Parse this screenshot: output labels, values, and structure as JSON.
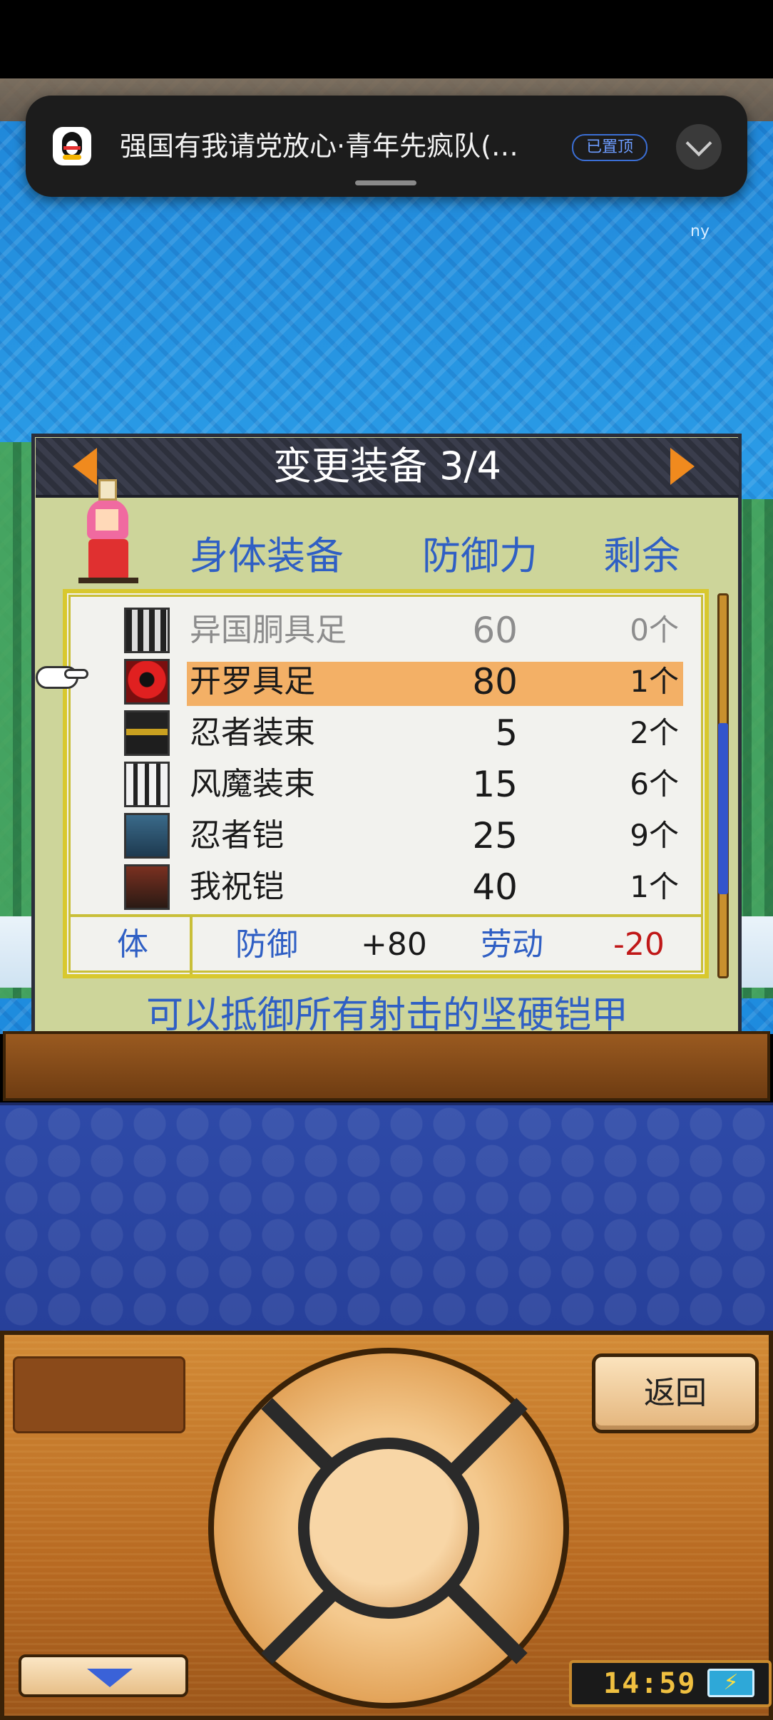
{
  "notification": {
    "app_icon": "qq-penguin-icon",
    "title": "强国有我请党放心·青年先疯队(…",
    "badge": "已置顶",
    "expand_icon": "chevron-down-icon"
  },
  "overlay_text": "ny",
  "dialog": {
    "title": "变更装备 3/4",
    "columns": {
      "body": "身体装备",
      "defense": "防御力",
      "remaining": "剩余"
    },
    "items": [
      {
        "name": "异国胴具足",
        "defense": "60",
        "remaining": "0个",
        "state": "disabled"
      },
      {
        "name": "开罗具足",
        "defense": "80",
        "remaining": "1个",
        "state": "selected"
      },
      {
        "name": "忍者装束",
        "defense": "5",
        "remaining": "2个",
        "state": "normal"
      },
      {
        "name": "风魔装束",
        "defense": "15",
        "remaining": "6个",
        "state": "normal"
      },
      {
        "name": "忍者铠",
        "defense": "25",
        "remaining": "9个",
        "state": "normal"
      },
      {
        "name": "我祝铠",
        "defense": "40",
        "remaining": "1个",
        "state": "normal"
      }
    ],
    "stats": {
      "body": "体",
      "defense_label": "防御",
      "defense_value": "+80",
      "labor_label": "劳动",
      "labor_value": "-20"
    },
    "description": "可以抵御所有射击的坚硬铠甲"
  },
  "controls": {
    "back": "返回",
    "clock": "14:59",
    "battery_symbol": "⚡"
  },
  "colors": {
    "accent_blue": "#2f5fc4",
    "selected_row": "#f3b066",
    "negative": "#c01818",
    "dialog_bg": "#cdd59a"
  }
}
